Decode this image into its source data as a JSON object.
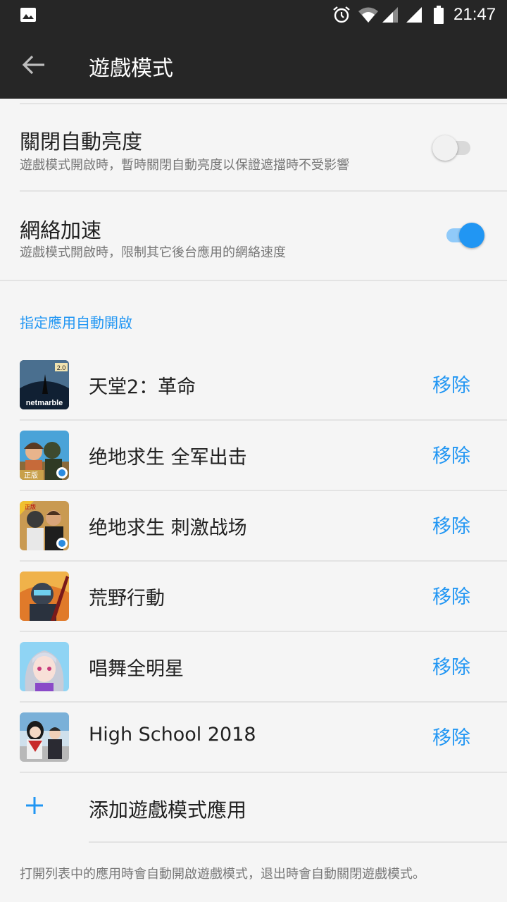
{
  "status_bar": {
    "time": "21:47",
    "icons": [
      "gallery-icon",
      "alarm-icon",
      "wifi-icon",
      "signal-icon",
      "signal-icon",
      "battery-icon"
    ]
  },
  "app_bar": {
    "title": "遊戲模式",
    "back_icon": "arrow-left-icon"
  },
  "settings": [
    {
      "title": "關閉自動亮度",
      "subtitle": "遊戲模式開啟時，暫時關閉自動亮度以保證遮擋時不受影響",
      "enabled": false
    },
    {
      "title": "網絡加速",
      "subtitle": "遊戲模式開啟時，限制其它後台應用的網絡速度",
      "enabled": true
    }
  ],
  "apps_section": {
    "header": "指定應用自動開啟",
    "remove_label": "移除",
    "apps": [
      {
        "name": "天堂2：革命",
        "icon_text": "netmarble",
        "badge": "2.0"
      },
      {
        "name": "绝地求生 全军出击",
        "badge": "正版"
      },
      {
        "name": "绝地求生 刺激战场",
        "badge": "正版"
      },
      {
        "name": "荒野行動"
      },
      {
        "name": "唱舞全明星"
      },
      {
        "name": "High School 2018"
      }
    ]
  },
  "add_app": {
    "label": "添加遊戲模式應用",
    "icon": "plus-icon"
  },
  "footer_note": "打開列表中的應用時會自動開啟遊戲模式，退出時會自動關閉遊戲模式。",
  "colors": {
    "accent": "#2196f3",
    "bar_background": "#262626",
    "page_background": "#f5f5f5",
    "divider": "#e3e3e3"
  }
}
